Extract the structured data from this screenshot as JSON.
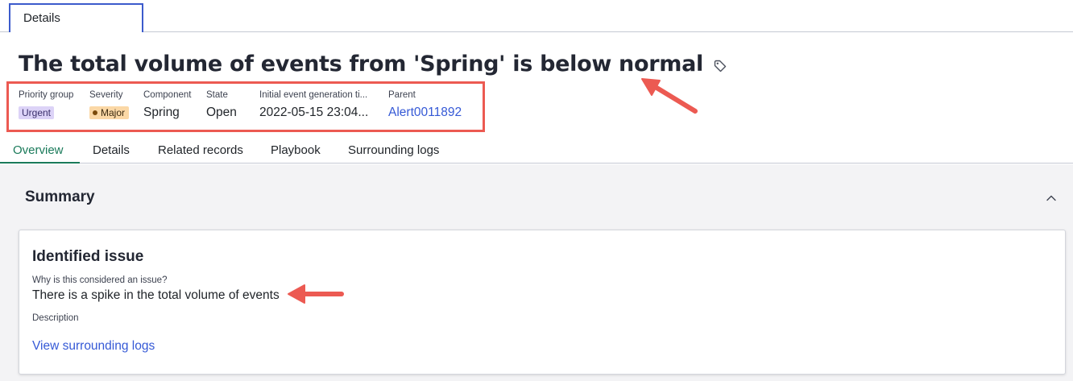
{
  "top_tab": {
    "label": "Details"
  },
  "header": {
    "title": "The total volume of events from 'Spring' is below normal",
    "tag_icon": "tag-icon"
  },
  "meta": {
    "priority_group": {
      "label": "Priority group",
      "value": "Urgent"
    },
    "severity": {
      "label": "Severity",
      "value": "Major"
    },
    "component": {
      "label": "Component",
      "value": "Spring"
    },
    "state": {
      "label": "State",
      "value": "Open"
    },
    "initial_event": {
      "label": "Initial event generation ti...",
      "value": "2022-05-15 23:04..."
    },
    "parent": {
      "label": "Parent",
      "value": "Alert0011892"
    }
  },
  "tabs": [
    {
      "label": "Overview",
      "active": true
    },
    {
      "label": "Details"
    },
    {
      "label": "Related records"
    },
    {
      "label": "Playbook"
    },
    {
      "label": "Surrounding logs"
    }
  ],
  "summary": {
    "title": "Summary",
    "collapse_icon": "chevron-up-icon",
    "card": {
      "title": "Identified issue",
      "question_label": "Why is this considered an issue?",
      "question_answer": "There is a spike in the total volume of events",
      "description_label": "Description",
      "link_label": "View surrounding logs"
    }
  },
  "colors": {
    "accent_green": "#1a7a5a",
    "link_blue": "#3559d6",
    "annotation_red": "#ec5a52",
    "urgent_badge": "#dcd3f7",
    "major_badge": "#fbd8a6"
  }
}
